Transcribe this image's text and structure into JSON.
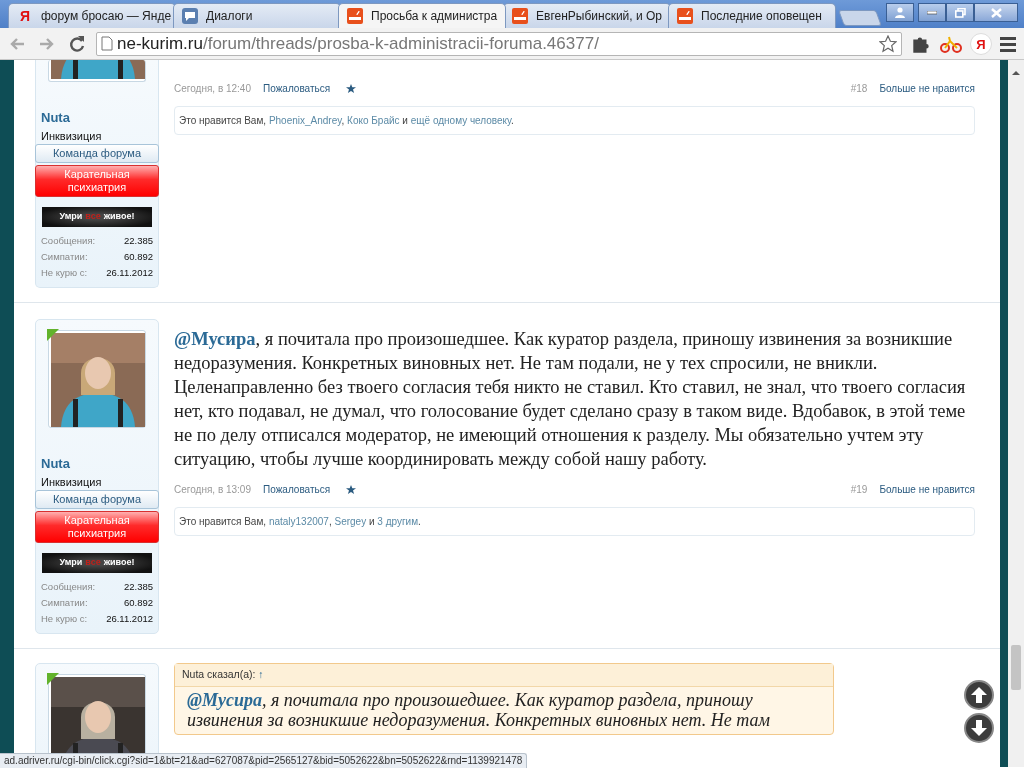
{
  "browser": {
    "tabs": [
      {
        "title": "форум бросаю — Янде",
        "kind": "yandex",
        "icon_text": "Я",
        "selected": false
      },
      {
        "title": "Диалоги",
        "kind": "chat",
        "selected": false
      },
      {
        "title": "Просьба к администра",
        "kind": "site",
        "selected": true
      },
      {
        "title": "ЕвгенРыбинский, и Ор",
        "kind": "site",
        "selected": false
      },
      {
        "title": "Последние оповещен",
        "kind": "site",
        "selected": false
      }
    ],
    "address": {
      "host": "ne-kurim.ru",
      "path": "/forum/threads/prosba-k-administracii-foruma.46377/"
    },
    "yandex_button": "Я"
  },
  "posts": [
    {
      "cut_top": true,
      "sidebar": {
        "name": "Nuta",
        "title": "Инквизиция",
        "banners": [
          {
            "kind": "team",
            "text": "Команда форума"
          },
          {
            "kind": "punitive",
            "text": "Карательная психиатрия"
          }
        ],
        "userbar": [
          {
            "text": "Умри",
            "color": "#ffffff"
          },
          {
            "text": "все",
            "color": "#c0201a"
          },
          {
            "text": "живое!",
            "color": "#ffffff"
          }
        ],
        "stats": [
          {
            "label": "Сообщения:",
            "value": "22.385"
          },
          {
            "label": "Симпатии:",
            "value": "60.892"
          },
          {
            "label": "Не курю с:",
            "value": "26.11.2012"
          }
        ]
      },
      "footer": {
        "date": "Сегодня, в 12:40",
        "report": "Пожаловаться",
        "number": "#18",
        "unlike": "Больше не нравится"
      },
      "likes": [
        {
          "text": "Это нравится Вам, "
        },
        {
          "text": "Phoenix_Andrey",
          "link": true
        },
        {
          "text": ", "
        },
        {
          "text": "Коко Брайс",
          "link": true
        },
        {
          "text": " и "
        },
        {
          "text": "ещё одному человеку",
          "link": true
        },
        {
          "text": "."
        }
      ]
    },
    {
      "cut_top": false,
      "sidebar": {
        "name": "Nuta",
        "title": "Инквизиция",
        "banners": [
          {
            "kind": "team",
            "text": "Команда форума"
          },
          {
            "kind": "punitive",
            "text": "Карательная психиатрия"
          }
        ],
        "userbar": [
          {
            "text": "Умри",
            "color": "#ffffff"
          },
          {
            "text": "все",
            "color": "#c0201a"
          },
          {
            "text": "живое!",
            "color": "#ffffff"
          }
        ],
        "stats": [
          {
            "label": "Сообщения:",
            "value": "22.385"
          },
          {
            "label": "Симпатии:",
            "value": "60.892"
          },
          {
            "label": "Не курю с:",
            "value": "26.11.2012"
          }
        ]
      },
      "body": {
        "mention": "@Мусира",
        "text": ", я почитала про произошедшее. Как куратор раздела, приношу извинения за возникшие недоразумения. Конкретных виновных нет. Не там подали, не у тех спросили, не вникли. Целенаправленно без твоего согласия тебя никто не ставил. Кто ставил, не знал, что твоего согласия нет, кто подавал, не думал, что голосование будет сделано сразу в таком виде. Вдобавок, в этой теме не по делу отписался модератор, не имеющий отношения к разделу. Мы обязательно учтем эту ситуацию, чтобы лучше координировать между собой нашу работу."
      },
      "footer": {
        "date": "Сегодня, в 13:09",
        "report": "Пожаловаться",
        "number": "#19",
        "unlike": "Больше не нравится"
      },
      "likes": [
        {
          "text": "Это нравится Вам, "
        },
        {
          "text": "nataly132007",
          "link": true
        },
        {
          "text": ", "
        },
        {
          "text": "Sergey",
          "link": true
        },
        {
          "text": " и "
        },
        {
          "text": "3 другим",
          "link": true
        },
        {
          "text": "."
        }
      ]
    },
    {
      "cut_top": false,
      "quote": {
        "author": "Nuta сказал(а):",
        "jump": "↑",
        "mention": "@Мусира",
        "lines": [
          ", я почитала про произошедшее. Как куратор раздела, приношу",
          "извинения за возникшие недоразумения. Конкретных виновных нет. Не там"
        ]
      }
    }
  ],
  "status_bar": "ad.adriver.ru/cgi-bin/click.cgi?sid=1&bt=21&ad=627087&pid=2565127&bid=5052622&bn=5052622&rnd=1139921478"
}
